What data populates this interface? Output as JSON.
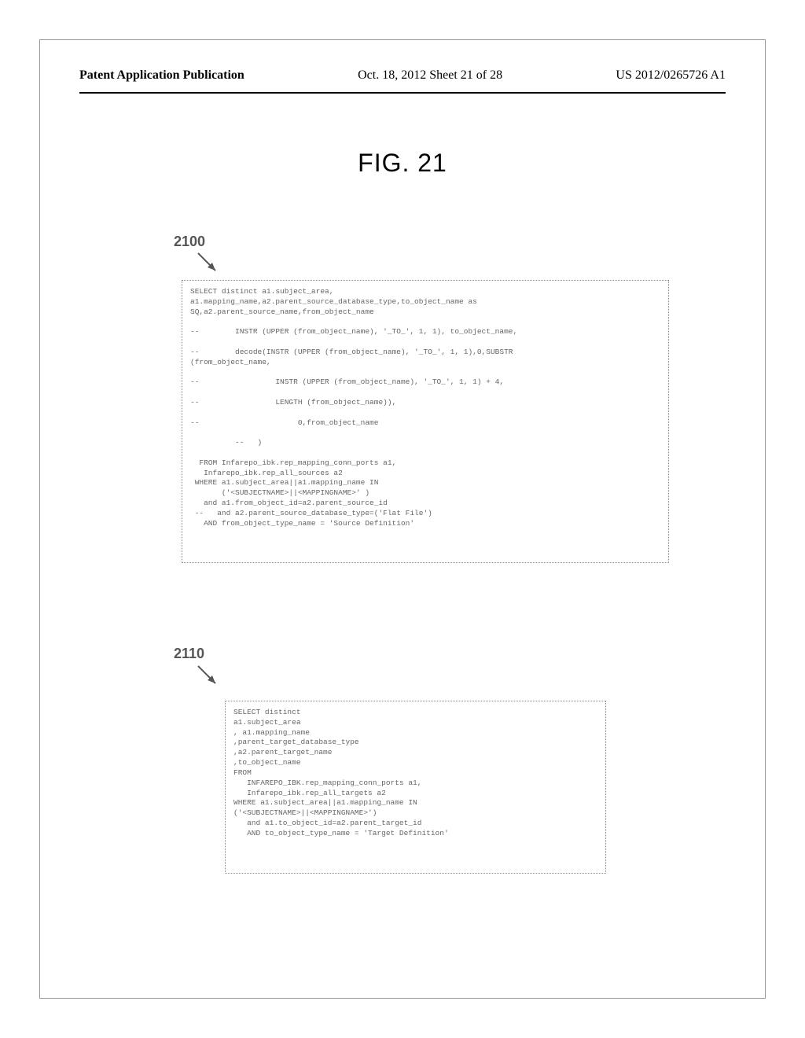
{
  "header": {
    "left": "Patent Application Publication",
    "center": "Oct. 18, 2012  Sheet 21 of 28",
    "right": "US 2012/0265726 A1"
  },
  "figure_title": "FIG. 21",
  "callouts": {
    "first": "2100",
    "second": "2110"
  },
  "code_2100": "SELECT distinct a1.subject_area,\na1.mapping_name,a2.parent_source_database_type,to_object_name as\nSQ,a2.parent_source_name,from_object_name\n\n--        INSTR (UPPER (from_object_name), '_TO_', 1, 1), to_object_name,\n\n--        decode(INSTR (UPPER (from_object_name), '_TO_', 1, 1),0,SUBSTR\n(from_object_name,\n\n--                 INSTR (UPPER (from_object_name), '_TO_', 1, 1) + 4,\n\n--                 LENGTH (from_object_name)),\n\n--                      0,from_object_name\n\n          --   )\n\n  FROM Infarepo_ibk.rep_mapping_conn_ports a1,\n   Infarepo_ibk.rep_all_sources a2\n WHERE a1.subject_area||a1.mapping_name IN\n       ('<SUBJECTNAME>||<MAPPINGNAME>' )\n   and a1.from_object_id=a2.parent_source_id\n --   and a2.parent_source_database_type=('Flat File')\n   AND from_object_type_name = 'Source Definition'",
  "code_2110": "SELECT distinct\na1.subject_area\n, a1.mapping_name\n,parent_target_database_type\n,a2.parent_target_name\n,to_object_name\nFROM\n   INFAREPO_IBK.rep_mapping_conn_ports a1,\n   Infarepo_ibk.rep_all_targets a2\nWHERE a1.subject_area||a1.mapping_name IN\n('<SUBJECTNAME>||<MAPPINGNAME>')\n   and a1.to_object_id=a2.parent_target_id\n   AND to_object_type_name = 'Target Definition'"
}
